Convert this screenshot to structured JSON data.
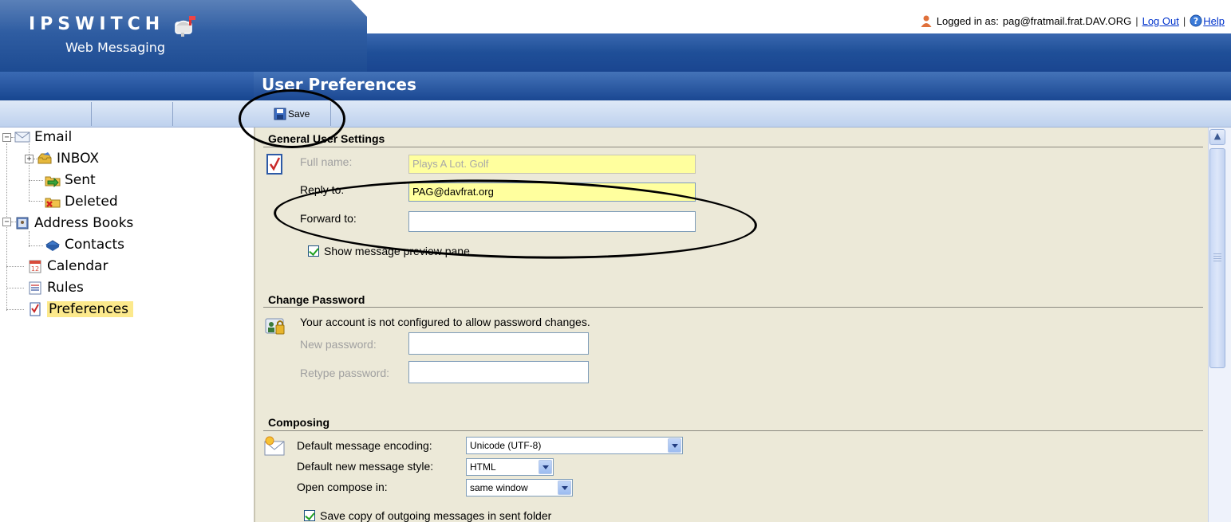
{
  "app": {
    "logo": "IPSWITCH",
    "logo_sub": "Web Messaging"
  },
  "userbar": {
    "logged_in_label": "Logged in as:",
    "user": "pag@fratmail.frat.DAV.ORG",
    "logout": "Log Out",
    "help": "Help"
  },
  "page": {
    "title": "User Preferences"
  },
  "toolbar": {
    "save_label": "Save"
  },
  "tree": {
    "email": "Email",
    "inbox": "INBOX",
    "sent": "Sent",
    "deleted": "Deleted",
    "address_books": "Address Books",
    "contacts": "Contacts",
    "calendar": "Calendar",
    "rules": "Rules",
    "preferences": "Preferences"
  },
  "general": {
    "heading": "General User Settings",
    "full_name_label": "Full name:",
    "full_name_value": "Plays A Lot. Golf",
    "reply_to_label": "Reply to:",
    "reply_to_value": "PAG@davfrat.org",
    "forward_to_label": "Forward to:",
    "forward_to_value": "",
    "preview_pane_label": "Show message preview pane",
    "preview_pane_checked": true
  },
  "password": {
    "heading": "Change Password",
    "notice": "Your account is not configured to allow password changes.",
    "new_label": "New password:",
    "retype_label": "Retype password:"
  },
  "composing": {
    "heading": "Composing",
    "encoding_label": "Default message encoding:",
    "encoding_value": "Unicode (UTF-8)",
    "style_label": "Default new message style:",
    "style_value": "HTML",
    "open_label": "Open compose in:",
    "open_value": "same window",
    "save_copy_label": "Save copy of outgoing messages in sent folder",
    "save_copy_checked": true
  },
  "colors": {
    "header_blue": "#1f4f98",
    "highlight_yellow": "#ffff9e",
    "content_bg": "#ece9d8",
    "link_blue": "#0033cc"
  }
}
